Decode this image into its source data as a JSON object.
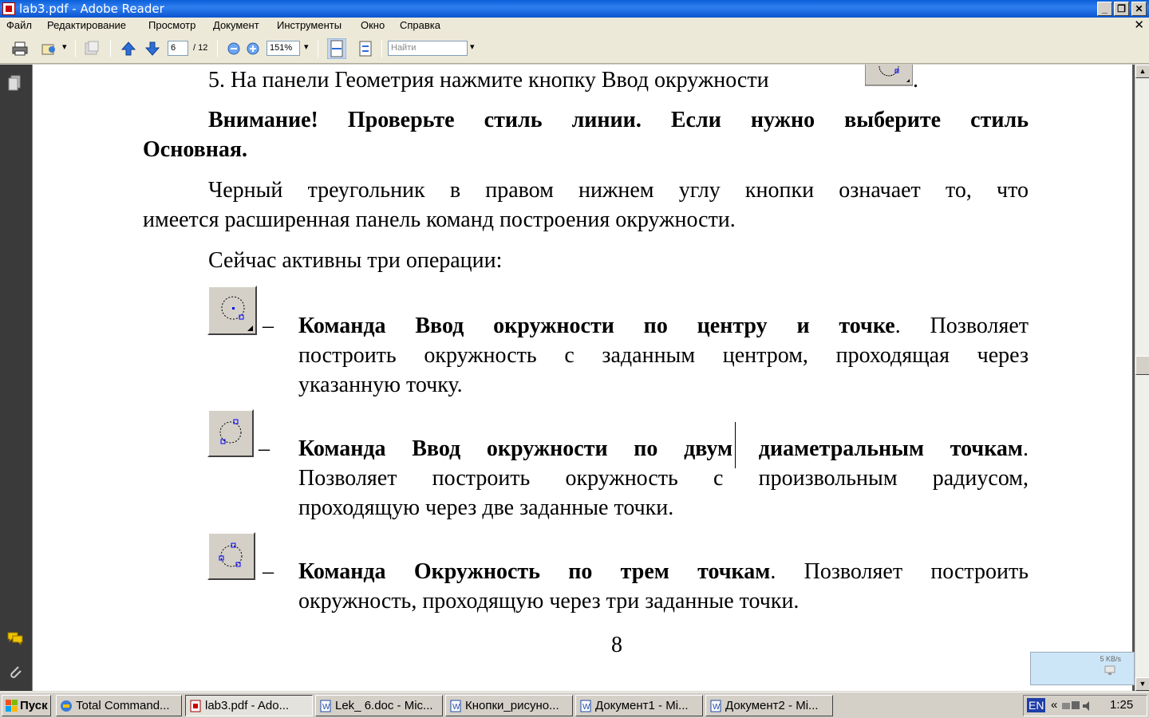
{
  "window": {
    "title": "lab3.pdf - Adobe Reader"
  },
  "menu": {
    "items": [
      "Файл",
      "Редактирование",
      "Просмотр",
      "Документ",
      "Инструменты",
      "Окно",
      "Справка"
    ]
  },
  "toolbar": {
    "current_page": "6",
    "total_pages": "/ 12",
    "zoom": "151%",
    "search_placeholder": "Найти"
  },
  "document": {
    "step5": "5. На панели Геометрия нажмите кнопку Ввод окружности",
    "step5_end": ".",
    "warning_line1": "Внимание! Проверьте стиль линии. Если нужно выберите стиль",
    "warning_line2": "Основная.",
    "para1_line1": "Черный треугольник в правом нижнем углу кнопки означает то, что",
    "para1_line2": "имеется расширенная панель команд построения окружности.",
    "para2": "Сейчас активны три операции:",
    "items": [
      {
        "dash": "–",
        "bold": "Команда Ввод окружности по центру и точке",
        "line1_rest": ". Позволяет",
        "line2": "построить окружность с заданным центром, проходящая через",
        "line3": "указанную точку."
      },
      {
        "dash": "–",
        "bold": "Команда Ввод окружности по двум диаметральным точкам",
        "line1_rest": ".",
        "line2": "Позволяет построить окружность с произвольным радиусом,",
        "line3": "проходящую через две заданные точки."
      },
      {
        "dash": "–",
        "bold": "Команда Окружность по трем точкам",
        "line1_rest": ". Позволяет построить",
        "line2": "окружность, проходящую через три заданные точки.",
        "line3": ""
      }
    ],
    "page_number": "8"
  },
  "net_widget": {
    "speed": "5 KB/s"
  },
  "taskbar": {
    "start": "Пуск",
    "tasks": [
      "Total Command...",
      "lab3.pdf - Ado...",
      "Lek_ 6.doc - Mic...",
      "Кнопки_рисуно...",
      "Документ1 - Mi...",
      "Документ2 - Mi..."
    ],
    "lang": "EN",
    "clock": "1:25"
  },
  "colors": {
    "titlebar": "#0a5fd8",
    "leftpanel": "#3a3a3a",
    "icon_blue": "#0000ff"
  }
}
